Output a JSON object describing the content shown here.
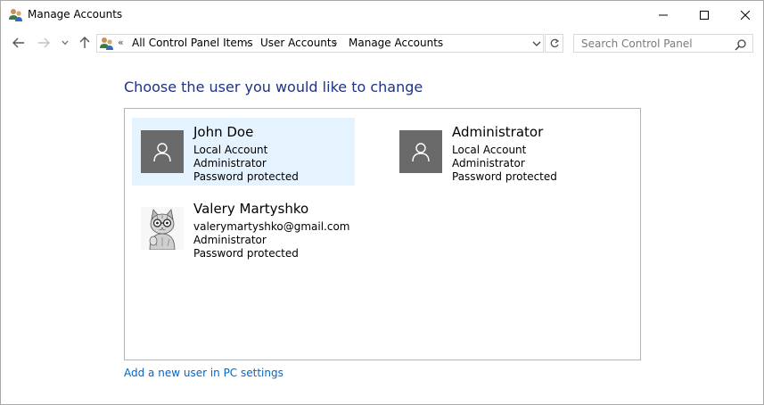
{
  "window": {
    "title": "Manage Accounts",
    "controls": [
      "minimize",
      "maximize",
      "close"
    ]
  },
  "address_bar": {
    "overflow_indicator": "«",
    "crumbs": [
      "All Control Panel Items",
      "User Accounts",
      "Manage Accounts"
    ],
    "separator": "›"
  },
  "search": {
    "placeholder": "Search Control Panel"
  },
  "main": {
    "heading": "Choose the user you would like to change",
    "accounts": [
      {
        "name": "John Doe",
        "lines": [
          "Local Account",
          "Administrator",
          "Password protected"
        ],
        "selected": true,
        "avatar": "default-user-icon"
      },
      {
        "name": "Administrator",
        "lines": [
          "Local Account",
          "Administrator",
          "Password protected"
        ],
        "selected": false,
        "avatar": "default-user-icon"
      },
      {
        "name": "Valery Martyshko",
        "lines": [
          "valerymartyshko@gmail.com",
          "Administrator",
          "Password protected"
        ],
        "selected": false,
        "avatar": "cat-photo"
      }
    ],
    "add_user_link": "Add a new user in PC settings"
  },
  "colors": {
    "heading": "#1e3287",
    "link": "#0066cc",
    "selected_bg": "#e5f3ff",
    "avatar_bg": "#6a6a6a",
    "panel_border": "#b4b4b4"
  }
}
